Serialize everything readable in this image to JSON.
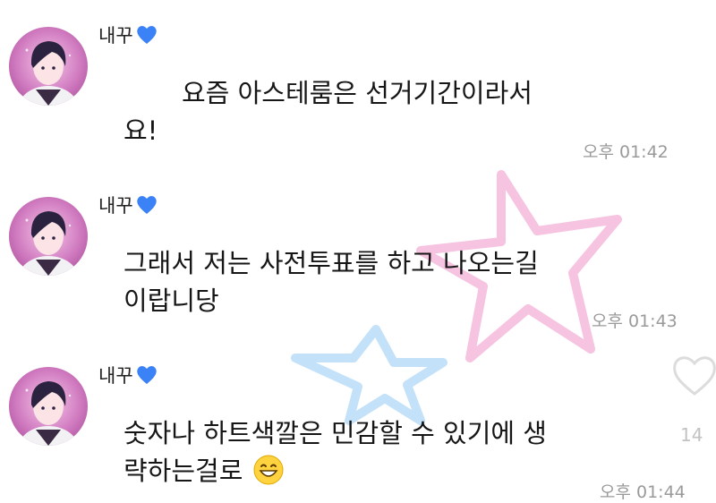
{
  "messages": [
    {
      "sender": "내꾸",
      "lines": [
        "요즘 아스테룸은 선거기간이라서",
        "요!"
      ],
      "time": "오후 01:42"
    },
    {
      "sender": "내꾸",
      "lines": [
        "그래서 저는 사전투표를 하고 나오는길",
        "이랍니당"
      ],
      "time": "오후 01:43"
    },
    {
      "sender": "내꾸",
      "lines": [
        "숫자나 하트색깔은 민감할 수 있기에 생",
        "략하는걸로"
      ],
      "time": "오후 01:44"
    }
  ],
  "like_count": "14",
  "icons": {
    "sender_badge": "blue-heart-icon",
    "reaction": "heart-outline-icon",
    "emoji": "grinning-smile-emoji-icon"
  },
  "colors": {
    "blue_heart": "#3b82f6",
    "avatar_bg": "#d07ac0",
    "time_text": "#9a9a9a",
    "star_pink": "#f4b8da",
    "star_blue": "#b9dcf7"
  }
}
